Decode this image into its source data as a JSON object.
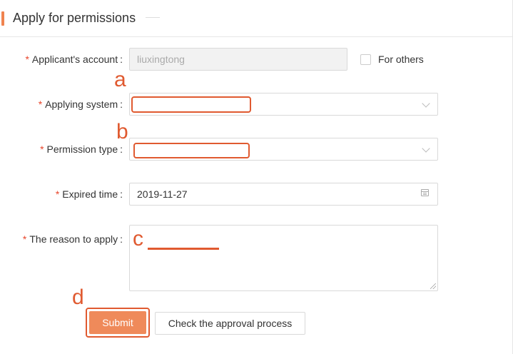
{
  "header": {
    "title": "Apply for permissions"
  },
  "form": {
    "applicant": {
      "label": "Applicant's account",
      "value": "liuxingtong",
      "required": "*"
    },
    "for_others": {
      "label": "For others"
    },
    "system": {
      "label": "Applying system",
      "required": "*",
      "value": ""
    },
    "permission_type": {
      "label": "Permission type",
      "required": "*",
      "value": ""
    },
    "expired": {
      "label": "Expired time",
      "required": "*",
      "value": "2019-11-27"
    },
    "reason": {
      "label": "The reason to apply",
      "required": "*",
      "value": ""
    },
    "colon": ":"
  },
  "annotations": {
    "a": "a",
    "b": "b",
    "c": "c",
    "d": "d"
  },
  "buttons": {
    "submit": "Submit",
    "approval": "Check the approval process"
  },
  "colors": {
    "accent": "#f0834f",
    "annotation": "#e05a30",
    "required": "#e8452b"
  }
}
